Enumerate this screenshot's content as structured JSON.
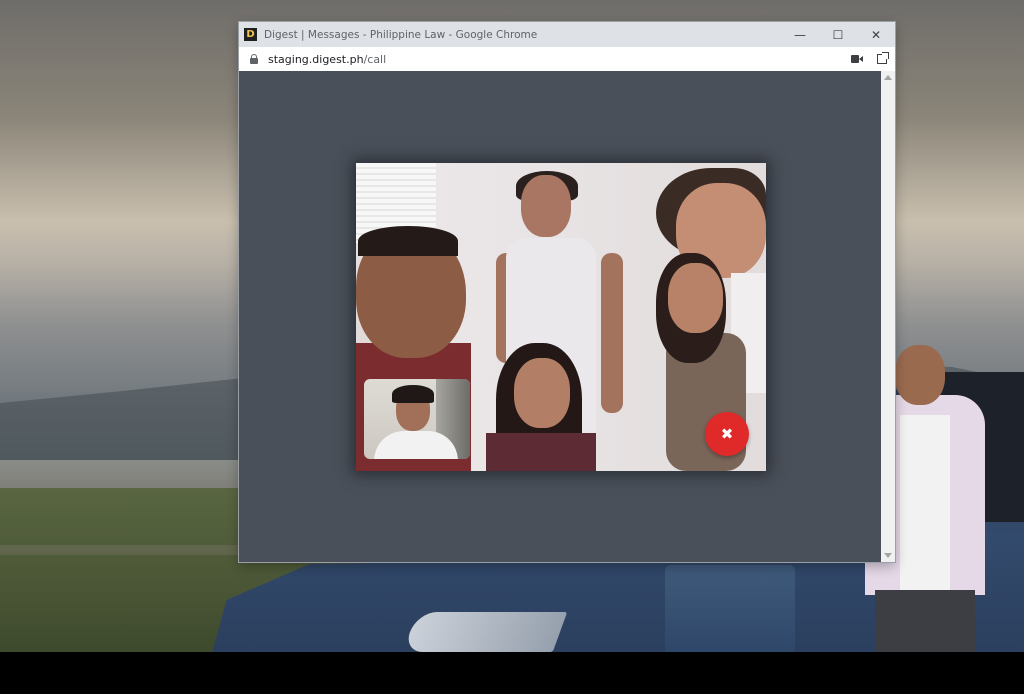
{
  "window": {
    "title": "Digest | Messages - Philippine Law - Google Chrome",
    "app_logo_letter": "D",
    "controls": {
      "minimize": "—",
      "maximize": "☐",
      "close": "✕"
    }
  },
  "address_bar": {
    "domain": "staging.digest.ph",
    "path": "/call",
    "icons": [
      "lock-icon",
      "video-camera-icon",
      "open-in-new-window-icon"
    ]
  },
  "call": {
    "end_call_glyph": "✖",
    "icons": [
      "close-icon"
    ],
    "colors": {
      "end_call": "#e02a2a",
      "page_background": "#4a5059"
    }
  }
}
